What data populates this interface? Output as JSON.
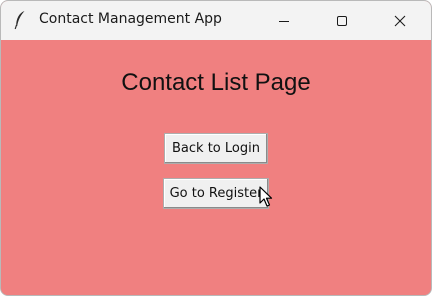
{
  "window": {
    "title": "Contact Management App",
    "controls": {
      "minimize": "minimize-icon",
      "maximize": "maximize-icon",
      "close": "close-icon"
    },
    "background_color": "#f08080"
  },
  "page": {
    "heading": "Contact List Page",
    "buttons": {
      "back_to_login": "Back to Login",
      "go_to_register": "Go to Register"
    }
  }
}
